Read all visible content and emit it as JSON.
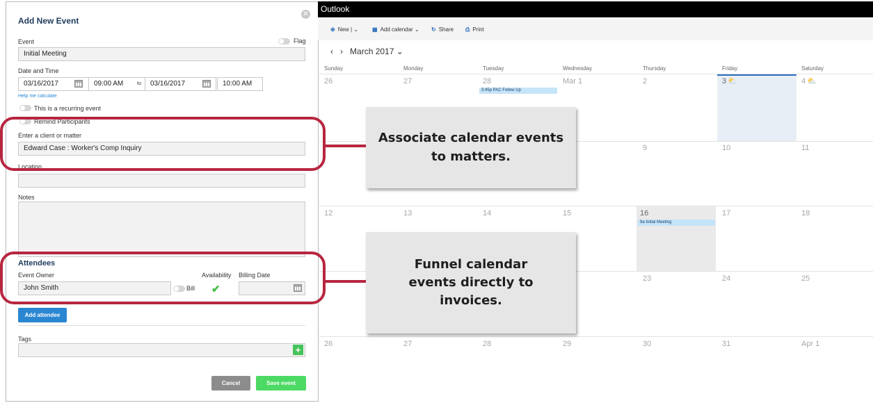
{
  "form": {
    "title": "Add New Event",
    "event_label": "Event",
    "flag_label": "Flag",
    "event_value": "Initial Meeting",
    "datetime_label": "Date and Time",
    "start_date": "03/16/2017",
    "start_time": "09:00 AM",
    "to_label": "to",
    "end_date": "03/16/2017",
    "end_time": "10:00 AM",
    "help_link": "Help me calculate",
    "recurring_label": "This is a recurring event",
    "remind_label": "Remind Participants",
    "client_label": "Enter a client or matter",
    "client_value": "Edward Case : Worker's Comp Inquiry",
    "location_label": "Location",
    "location_value": "",
    "notes_label": "Notes",
    "notes_value": "",
    "attendees_heading": "Attendees",
    "owner_label": "Event Owner",
    "availability_label": "Availability",
    "billing_date_label": "Billing Date",
    "owner_value": "John Smith",
    "bill_label": "Bill",
    "add_attendee": "Add attendee",
    "tags_label": "Tags",
    "cancel": "Cancel",
    "save": "Save event"
  },
  "outlook": {
    "app_title": "Outlook",
    "toolbar": {
      "new": "New",
      "add_calendar": "Add calendar",
      "share": "Share",
      "print": "Print"
    },
    "month": "March 2017",
    "days": [
      "Sunday",
      "Monday",
      "Tuesday",
      "Wednesday",
      "Thursday",
      "Friday",
      "Saturday"
    ],
    "row1": [
      "26",
      "27",
      "28",
      "Mar 1",
      "2",
      "3",
      "4"
    ],
    "row2": [
      "9",
      "10",
      "11"
    ],
    "row3": [
      "12",
      "13",
      "14",
      "15",
      "16",
      "17",
      "18"
    ],
    "row4": [
      "23",
      "24",
      "25"
    ],
    "row5": [
      "26",
      "27",
      "28",
      "29",
      "30",
      "31",
      "Apr 1"
    ],
    "events": {
      "tue": "3:45p PAC Follow Up",
      "thu": "9a Initial Meeting"
    }
  },
  "callouts": {
    "top": "Associate calendar events to matters.",
    "bottom": "Funnel calendar events directly to invoices."
  },
  "colors": {
    "accent": "#b7263f",
    "primary_button": "#2a86d1",
    "save_button": "#4cd964",
    "cancel_button": "#8c8c8c",
    "event_bg": "#c5e4f7"
  }
}
